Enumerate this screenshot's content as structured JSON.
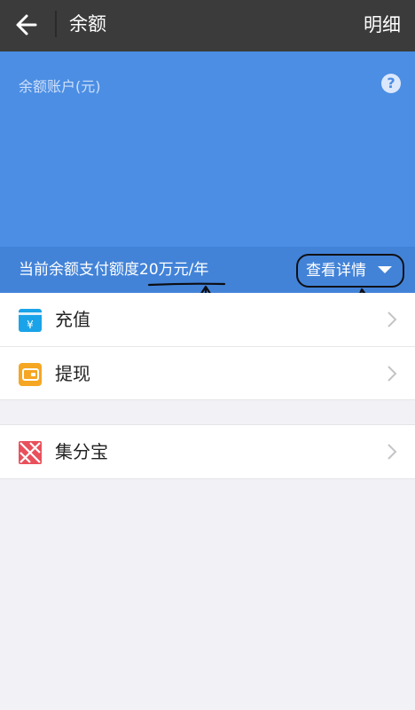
{
  "header": {
    "title": "余额",
    "right_action": "明细",
    "back_icon": "arrow-left-icon"
  },
  "balance": {
    "account_label": "余额账户(元)",
    "help_icon": "question-mark-icon"
  },
  "quota": {
    "text": "当前余额支付额度20万元/年",
    "details_label": "查看详情",
    "details_icon": "caret-down-icon"
  },
  "actions": [
    {
      "label": "充值",
      "icon": "yuan-card-icon",
      "color": "#1aa3e8"
    },
    {
      "label": "提现",
      "icon": "wallet-icon",
      "color": "#f5a623"
    }
  ],
  "extras": [
    {
      "label": "集分宝",
      "icon": "jifenbao-icon",
      "color": "#e9505b"
    }
  ],
  "theme": {
    "appbar": "#3b3b3b",
    "card": "#4b8ee4",
    "quota_bar": "#4283d8",
    "background": "#f2f2f6"
  }
}
